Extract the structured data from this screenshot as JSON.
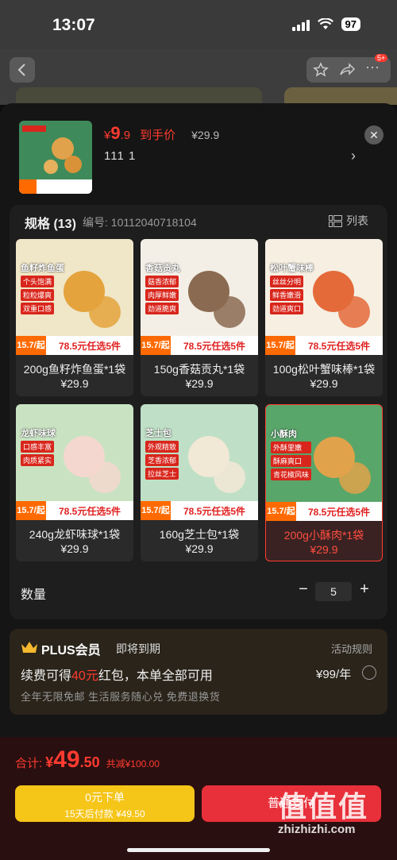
{
  "status_bar": {
    "time": "13:07",
    "battery": "97"
  },
  "header": {
    "price_currency": "¥",
    "price_int": "9",
    "price_dec": ".9",
    "price_tag": "到手价",
    "original_price": "¥29.9",
    "selected_spec": "111  1",
    "notif_badge": "5+"
  },
  "spec": {
    "title": "规格 (13)",
    "code": "编号: 10112040718104",
    "list_view_label": "列表"
  },
  "items": [
    {
      "name": "200g鱼籽炸鱼蛋*1袋",
      "price": "¥29.9",
      "img_label": "鱼籽炸鱼蛋",
      "chips": [
        "个头饱满",
        "粒粒爆爽",
        "双重口感"
      ],
      "promo_left": "15.7/起",
      "promo": "78.5元任选5件",
      "selected": false
    },
    {
      "name": "150g香菇贡丸*1袋",
      "price": "¥29.9",
      "img_label": "香菇贡丸",
      "chips": [
        "菇香浓郁",
        "肉厚鲜嫩",
        "劲道脆爽"
      ],
      "promo_left": "15.7/起",
      "promo": "78.5元任选5件",
      "selected": false
    },
    {
      "name": "100g松叶蟹味棒*1袋",
      "price": "¥29.9",
      "img_label": "松叶蟹味棒",
      "chips": [
        "丝丝分明",
        "鲜香嫩滑",
        "劲道爽口"
      ],
      "promo_left": "15.7/起",
      "promo": "78.5元任选5件",
      "selected": false
    },
    {
      "name": "240g龙虾味球*1袋",
      "price": "¥29.9",
      "img_label": "龙虾味球",
      "chips": [
        "口感丰富",
        "肉质紧实"
      ],
      "promo_left": "15.7/起",
      "promo": "78.5元任选5件",
      "selected": false
    },
    {
      "name": "160g芝士包*1袋",
      "price": "¥29.9",
      "img_label": "芝士包",
      "chips": [
        "外观精致",
        "芝香浓郁",
        "拉丝芝士"
      ],
      "promo_left": "15.7/起",
      "promo": "78.5元任选5件",
      "selected": false
    },
    {
      "name": "200g小酥肉*1袋",
      "price": "¥29.9",
      "img_label": "小酥肉",
      "chips": [
        "外酥里嫩",
        "酥麻爽口",
        "青花椒风味"
      ],
      "promo_left": "15.7/起",
      "promo": "78.5元任选5件",
      "selected": true
    }
  ],
  "quantity": {
    "label": "数量",
    "value": "5",
    "minus": "−",
    "plus": "+"
  },
  "plus": {
    "title": "PLUS会员",
    "expiring": "即将到期",
    "rules": "活动规则",
    "renew_pre": "续费可得",
    "renew_amount": "40元",
    "renew_post": "红包，本单全部可用",
    "price": "¥99/年",
    "benefits": "全年无限免邮 生活服务随心兑 免费退换货"
  },
  "footer": {
    "total_label": "合计:",
    "total_currency": "¥",
    "total_int": "49",
    "total_dec": ".50",
    "saving": "共减¥100.00",
    "credit_line1": "0元下单",
    "credit_line2": "15天后付款 ¥49.50",
    "buy_label": "普通支付"
  },
  "watermark": {
    "glyphs": "值值值",
    "url": "zhizhizhi.com"
  },
  "colors": {
    "accent_red": "#ff3b30",
    "credit_yellow": "#f5c518",
    "buy_red": "#e8303a"
  }
}
